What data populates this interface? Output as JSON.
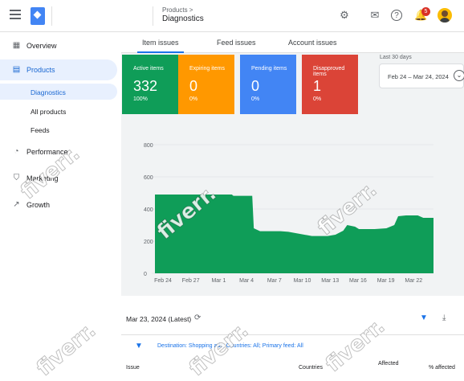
{
  "header": {
    "breadcrumb": "Products >",
    "title": "Diagnostics",
    "notification_count": "5"
  },
  "sidebar": {
    "items": [
      {
        "label": "Overview",
        "icon": "overview-icon"
      },
      {
        "label": "Products",
        "icon": "products-icon"
      },
      {
        "label": "Performance",
        "icon": "performance-icon"
      },
      {
        "label": "Marketing",
        "icon": "marketing-icon"
      },
      {
        "label": "Growth",
        "icon": "growth-icon"
      }
    ],
    "subitems": [
      "Diagnostics",
      "All products",
      "Feeds"
    ]
  },
  "tabs": [
    "Item issues",
    "Feed issues",
    "Account issues"
  ],
  "cards": [
    {
      "title": "Active items",
      "value": "332",
      "pct": "100%",
      "color": "#0f9d58"
    },
    {
      "title": "Expiring items",
      "value": "0",
      "pct": "0%",
      "color": "#ff9800"
    },
    {
      "title": "Pending items",
      "value": "0",
      "pct": "0%",
      "color": "#4285f4"
    },
    {
      "title": "Disapproved items",
      "value": "1",
      "pct": "0%",
      "color": "#db4437"
    }
  ],
  "date_range": {
    "label": "Last 30 days",
    "value": "Feb 24 – Mar 24, 2024"
  },
  "chart_data": {
    "type": "area",
    "x": [
      "Feb 24",
      "Feb 27",
      "Mar 1",
      "Mar 4",
      "Mar 7",
      "Mar 10",
      "Mar 13",
      "Mar 16",
      "Mar 19",
      "Mar 22"
    ],
    "yticks": [
      "0",
      "200",
      "400",
      "600",
      "800"
    ],
    "ylim": [
      0,
      800
    ],
    "series": [
      {
        "color": "#db4437",
        "points": [
          [
            0,
            490
          ],
          [
            9.8,
            490
          ]
        ]
      },
      {
        "color": "#0f9d58",
        "points": [
          [
            0,
            490
          ],
          [
            9.8,
            490
          ],
          [
            10,
            482
          ],
          [
            12.4,
            482
          ],
          [
            12.6,
            280
          ],
          [
            13.4,
            262
          ],
          [
            16,
            262
          ],
          [
            17,
            258
          ],
          [
            20,
            232
          ],
          [
            22,
            232
          ],
          [
            23,
            240
          ],
          [
            24,
            265
          ],
          [
            24.5,
            300
          ],
          [
            25.5,
            290
          ],
          [
            26,
            275
          ],
          [
            28,
            275
          ],
          [
            29.5,
            280
          ],
          [
            30.5,
            300
          ],
          [
            31,
            355
          ],
          [
            32,
            360
          ],
          [
            33.5,
            360
          ],
          [
            34.2,
            345
          ],
          [
            35.5,
            345
          ]
        ]
      }
    ],
    "x_max": 35.5
  },
  "footer": {
    "date": "Mar 23, 2024 (Latest)",
    "filter_prefix": "Destination:",
    "filter_destination": "Shopping ads",
    "filter_countries_label": "; Countries:",
    "filter_countries": "All",
    "filter_feed_label": "; Primary feed:",
    "filter_feed": "All",
    "col_issue": "Issue",
    "col_countries": "Countries",
    "col_affected": "Affected",
    "col_pct": "% affected"
  },
  "watermark": "fiverr."
}
